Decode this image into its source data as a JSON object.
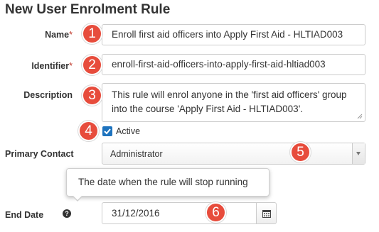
{
  "page": {
    "title": "New User Enrolment Rule"
  },
  "fields": {
    "name": {
      "label": "Name",
      "required_mark": "*",
      "value": "Enroll first aid officers into Apply First Aid - HLTIAD003"
    },
    "identifier": {
      "label": "Identifier",
      "required_mark": "*",
      "value": "enroll-first-aid-officers-into-apply-first-aid-hltiad003"
    },
    "description": {
      "label": "Description",
      "value": "This rule will enrol anyone in the 'first aid officers' group into the course 'Apply First Aid - HLTIAD003'."
    },
    "active": {
      "label": "Active",
      "checked": true
    },
    "primary_contact": {
      "label": "Primary Contact",
      "value": "Administrator"
    },
    "end_date": {
      "label": "End Date",
      "value": "31/12/2016",
      "tooltip": "The date when the rule will stop running"
    }
  },
  "badges": [
    "1",
    "2",
    "3",
    "4",
    "5",
    "6"
  ],
  "colors": {
    "badge": "#e74c3c",
    "checkbox": "#1e73be",
    "required": "#c0392b"
  },
  "icons": {
    "help": "question-circle-icon",
    "calendar": "calendar-icon",
    "select_arrow": "caret-down-icon",
    "check": "checkmark-icon"
  }
}
